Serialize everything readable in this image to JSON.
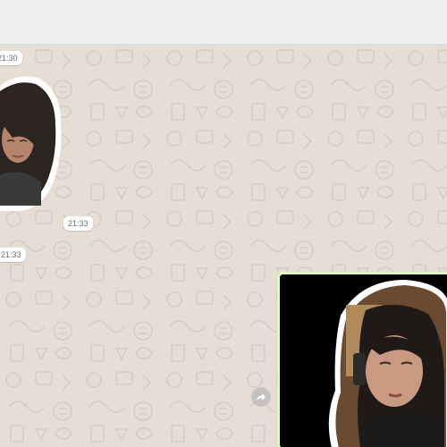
{
  "topbar": {},
  "chat": {
    "messages": [
      {
        "kind": "sticker",
        "time": "21:30"
      },
      {
        "kind": "sticker",
        "time": "21:33"
      },
      {
        "kind": "sticker",
        "time": "21:33"
      },
      {
        "kind": "image"
      }
    ]
  },
  "icons": {
    "forward": "forward-arrow-icon"
  },
  "colors": {
    "wallpaper": "#e6ded5",
    "outgoing_bubble": "#dcf8c6",
    "topbar": "#f0f0f0"
  }
}
